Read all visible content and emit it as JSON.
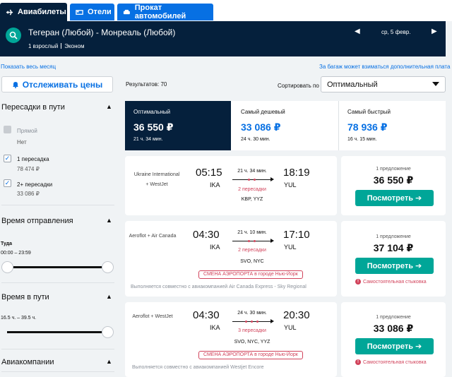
{
  "tabs": [
    {
      "label": "Авиабилеты",
      "icon": "plane-icon",
      "active": true
    },
    {
      "label": "Отели",
      "icon": "bed-icon",
      "active": false
    },
    {
      "label": "Прокат автомобилей",
      "icon": "car-icon",
      "active": false
    }
  ],
  "search": {
    "route": "Тегеран (Любой) - Монреаль (Любой)",
    "passengers": "1 взрослый",
    "cabin": "Эконом",
    "prev_arrow": "◀",
    "date": "ср, 5 февр.",
    "next_arrow": "▶"
  },
  "links": {
    "whole_month": "Показать весь месяц",
    "baggage_fee": "За багаж может взиматься дополнительная плата"
  },
  "track_button": "Отслеживать цены",
  "filters": {
    "stops": {
      "title": "Пересадки в пути",
      "chevron": "▲",
      "options": [
        {
          "label": "Прямой",
          "sub": "Нет",
          "checked": false,
          "disabled": true
        },
        {
          "label": "1 пересадка",
          "sub": "78 474 ₽",
          "checked": true,
          "disabled": false
        },
        {
          "label": "2+ пересадки",
          "sub": "33 086 ₽",
          "checked": true,
          "disabled": false
        }
      ]
    },
    "departure": {
      "title": "Время отправления",
      "chevron": "▲",
      "subtitle": "Туда",
      "range": "00:00 – 23:59"
    },
    "duration": {
      "title": "Время в пути",
      "chevron": "▲",
      "range": "16.5 ч. – 39.5 ч."
    },
    "airlines": {
      "title": "Авиакомпании",
      "chevron": "▲"
    }
  },
  "results": {
    "count_label": "Результатов: 70",
    "sort_label": "Сортировать по",
    "sort_value": "Оптимальный"
  },
  "summary": [
    {
      "title": "Оптимальный",
      "price": "36 550 ₽",
      "duration": "21 ч. 34 мин.",
      "active": true
    },
    {
      "title": "Самый дешевый",
      "price": "33 086 ₽",
      "duration": "24 ч. 30 мин.",
      "active": false
    },
    {
      "title": "Самый быстрый",
      "price": "78 936 ₽",
      "duration": "16 ч. 15 мин.",
      "active": false
    }
  ],
  "flights": [
    {
      "airline": "Ukraine International + WestJet",
      "dep_time": "05:15",
      "dep_code": "IKA",
      "arr_time": "18:19",
      "arr_code": "YUL",
      "duration": "21 ч. 34 мин.",
      "stops": "2 пересадки",
      "via": "KBP, YYZ",
      "warning": "",
      "operated_by": "",
      "offers": "1 предложение",
      "price": "36 550 ₽",
      "view_label": "Посмотреть ➔",
      "self_connection": ""
    },
    {
      "airline": "Aeroflot + Air Canada",
      "dep_time": "04:30",
      "dep_code": "IKA",
      "arr_time": "17:10",
      "arr_code": "YUL",
      "duration": "21 ч. 10 мин.",
      "stops": "2 пересадки",
      "via": "SVO, NYC",
      "warning": "СМЕНА АЭРОПОРТА в городе Нью-Йорк",
      "operated_by": "Выполняется совместно с авиакомпанией Air Canada Express - Sky Regional",
      "offers": "1 предложение",
      "price": "37 104 ₽",
      "view_label": "Посмотреть ➔",
      "self_connection": "Самостоятельная стыковка"
    },
    {
      "airline": "Aeroflot + WestJet",
      "dep_time": "04:30",
      "dep_code": "IKA",
      "arr_time": "20:30",
      "arr_code": "YUL",
      "duration": "24 ч. 30 мин.",
      "stops": "3 пересадки",
      "via": "SVO, NYC, YYZ",
      "warning": "СМЕНА АЭРОПОРТА в городе Нью-Йорк",
      "operated_by": "Выполняется совместно с авиакомпанией Westjet Encore",
      "offers": "1 предложение",
      "price": "33 086 ₽",
      "view_label": "Посмотреть ➔",
      "self_connection": "Самостоятельная стыковка"
    }
  ],
  "colors": {
    "navy": "#05203c",
    "blue": "#0770e3",
    "teal": "#00a698",
    "red": "#d1435b"
  }
}
